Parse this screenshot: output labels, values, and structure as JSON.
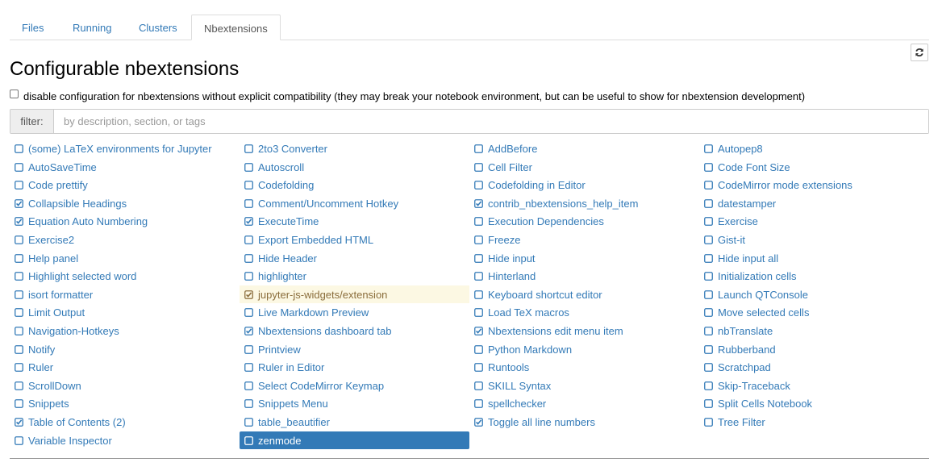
{
  "tabs": [
    {
      "label": "Files",
      "active": false
    },
    {
      "label": "Running",
      "active": false
    },
    {
      "label": "Clusters",
      "active": false
    },
    {
      "label": "Nbextensions",
      "active": true
    }
  ],
  "page_title": "Configurable nbextensions",
  "compat": {
    "label": "disable configuration for nbextensions without explicit compatibility (they may break your notebook environment, but can be useful to show for nbextension development)",
    "checked": false
  },
  "filter": {
    "label": "filter:",
    "placeholder": "by description, section, or tags",
    "value": ""
  },
  "refresh_icon": "refresh-icon",
  "colors": {
    "link": "#337ab7",
    "highlight_bg": "#fcf8e3",
    "highlight_text": "#8a6d3b",
    "selected_bg": "#337ab7"
  },
  "extensions": [
    [
      {
        "name": "(some) LaTeX environments for Jupyter",
        "checked": false
      },
      {
        "name": "AutoSaveTime",
        "checked": false
      },
      {
        "name": "Code prettify",
        "checked": false
      },
      {
        "name": "Collapsible Headings",
        "checked": true
      },
      {
        "name": "Equation Auto Numbering",
        "checked": true
      },
      {
        "name": "Exercise2",
        "checked": false
      },
      {
        "name": "Help panel",
        "checked": false
      },
      {
        "name": "Highlight selected word",
        "checked": false
      },
      {
        "name": "isort formatter",
        "checked": false
      },
      {
        "name": "Limit Output",
        "checked": false
      },
      {
        "name": "Navigation-Hotkeys",
        "checked": false
      },
      {
        "name": "Notify",
        "checked": false
      },
      {
        "name": "Ruler",
        "checked": false
      },
      {
        "name": "ScrollDown",
        "checked": false
      },
      {
        "name": "Snippets",
        "checked": false
      },
      {
        "name": "Table of Contents (2)",
        "checked": true
      },
      {
        "name": "Variable Inspector",
        "checked": false
      }
    ],
    [
      {
        "name": "2to3 Converter",
        "checked": false
      },
      {
        "name": "Autoscroll",
        "checked": false
      },
      {
        "name": "Codefolding",
        "checked": false
      },
      {
        "name": "Comment/Uncomment Hotkey",
        "checked": false
      },
      {
        "name": "ExecuteTime",
        "checked": true
      },
      {
        "name": "Export Embedded HTML",
        "checked": false
      },
      {
        "name": "Hide Header",
        "checked": false
      },
      {
        "name": "highlighter",
        "checked": false
      },
      {
        "name": "jupyter-js-widgets/extension",
        "checked": true,
        "state": "highlight"
      },
      {
        "name": "Live Markdown Preview",
        "checked": false
      },
      {
        "name": "Nbextensions dashboard tab",
        "checked": true
      },
      {
        "name": "Printview",
        "checked": false
      },
      {
        "name": "Ruler in Editor",
        "checked": false
      },
      {
        "name": "Select CodeMirror Keymap",
        "checked": false
      },
      {
        "name": "Snippets Menu",
        "checked": false
      },
      {
        "name": "table_beautifier",
        "checked": false
      },
      {
        "name": "zenmode",
        "checked": false,
        "state": "selected"
      }
    ],
    [
      {
        "name": "AddBefore",
        "checked": false
      },
      {
        "name": "Cell Filter",
        "checked": false
      },
      {
        "name": "Codefolding in Editor",
        "checked": false
      },
      {
        "name": "contrib_nbextensions_help_item",
        "checked": true
      },
      {
        "name": "Execution Dependencies",
        "checked": false
      },
      {
        "name": "Freeze",
        "checked": false
      },
      {
        "name": "Hide input",
        "checked": false
      },
      {
        "name": "Hinterland",
        "checked": false
      },
      {
        "name": "Keyboard shortcut editor",
        "checked": false
      },
      {
        "name": "Load TeX macros",
        "checked": false
      },
      {
        "name": "Nbextensions edit menu item",
        "checked": true
      },
      {
        "name": "Python Markdown",
        "checked": false
      },
      {
        "name": "Runtools",
        "checked": false
      },
      {
        "name": "SKILL Syntax",
        "checked": false
      },
      {
        "name": "spellchecker",
        "checked": false
      },
      {
        "name": "Toggle all line numbers",
        "checked": true
      }
    ],
    [
      {
        "name": "Autopep8",
        "checked": false
      },
      {
        "name": "Code Font Size",
        "checked": false
      },
      {
        "name": "CodeMirror mode extensions",
        "checked": false
      },
      {
        "name": "datestamper",
        "checked": false
      },
      {
        "name": "Exercise",
        "checked": false
      },
      {
        "name": "Gist-it",
        "checked": false
      },
      {
        "name": "Hide input all",
        "checked": false
      },
      {
        "name": "Initialization cells",
        "checked": false
      },
      {
        "name": "Launch QTConsole",
        "checked": false
      },
      {
        "name": "Move selected cells",
        "checked": false
      },
      {
        "name": "nbTranslate",
        "checked": false
      },
      {
        "name": "Rubberband",
        "checked": false
      },
      {
        "name": "Scratchpad",
        "checked": false
      },
      {
        "name": "Skip-Traceback",
        "checked": false
      },
      {
        "name": "Split Cells Notebook",
        "checked": false
      },
      {
        "name": "Tree Filter",
        "checked": false
      }
    ]
  ]
}
